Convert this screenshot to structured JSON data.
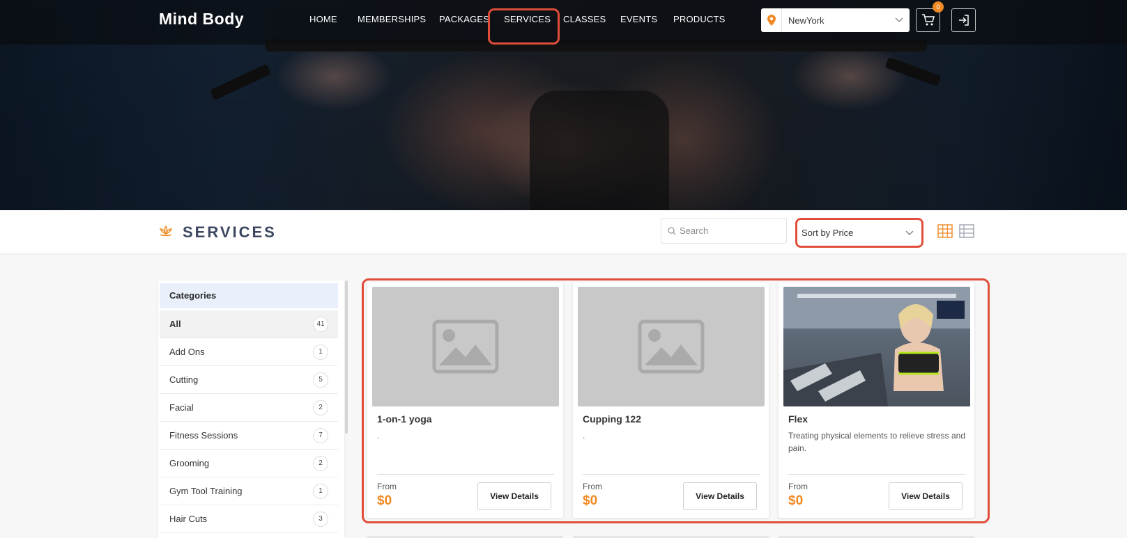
{
  "brand": {
    "logo": "Mind Body"
  },
  "nav": {
    "items": [
      "HOME",
      "MEMBERSHIPS",
      "PACKAGES",
      "SERVICES",
      "CLASSES",
      "EVENTS",
      "PRODUCTS"
    ],
    "active": "SERVICES"
  },
  "location": {
    "value": "NewYork"
  },
  "cart": {
    "count": "0"
  },
  "page": {
    "title": "SERVICES"
  },
  "search": {
    "placeholder": "Search"
  },
  "sort": {
    "label": "Sort by Price"
  },
  "sidebar": {
    "header": "Categories",
    "items": [
      {
        "label": "All",
        "count": "41"
      },
      {
        "label": "Add Ons",
        "count": "1"
      },
      {
        "label": "Cutting",
        "count": "5"
      },
      {
        "label": "Facial",
        "count": "2"
      },
      {
        "label": "Fitness Sessions",
        "count": "7"
      },
      {
        "label": "Grooming",
        "count": "2"
      },
      {
        "label": "Gym Tool Training",
        "count": "1"
      },
      {
        "label": "Hair Cuts",
        "count": "3"
      }
    ]
  },
  "cards": [
    {
      "name": "1-on-1 yoga",
      "desc": ".",
      "from": "From",
      "price": "$0",
      "button": "View Details"
    },
    {
      "name": "Cupping 122",
      "desc": ".",
      "from": "From",
      "price": "$0",
      "button": "View Details"
    },
    {
      "name": "Flex",
      "desc": "Treating physical elements to relieve stress and pain.",
      "from": "From",
      "price": "$0",
      "button": "View Details"
    }
  ],
  "colors": {
    "accent": "#f08a24",
    "highlight": "#e04e3a",
    "title": "#3b4660"
  }
}
